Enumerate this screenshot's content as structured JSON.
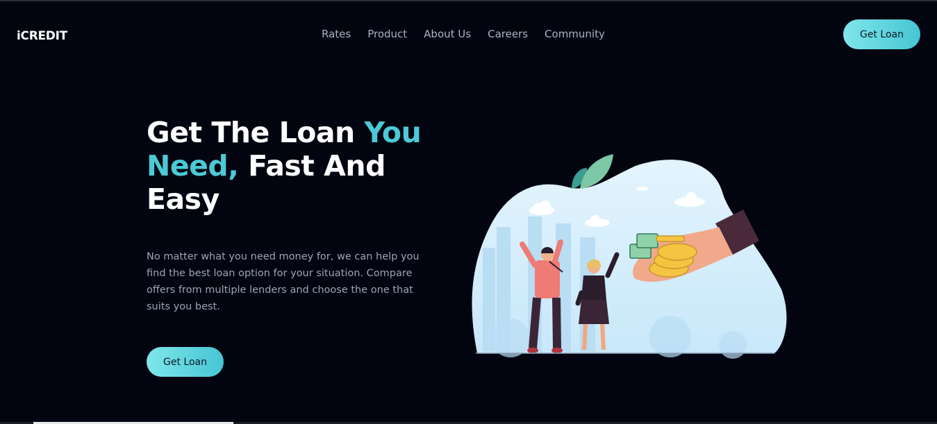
{
  "brand": {
    "logo": "iCREDIT"
  },
  "nav": {
    "items": [
      "Rates",
      "Product",
      "About Us",
      "Careers",
      "Community"
    ]
  },
  "header": {
    "cta_label": "Get Loan"
  },
  "hero": {
    "title_part1": "Get The Loan ",
    "title_accent": "You Need,",
    "title_part2": " Fast And Easy",
    "description": "No matter what you need money for, we can help you find the best loan option for your situation. Compare offers from multiple lenders and choose the one that suits you best.",
    "cta_label": "Get Loan"
  },
  "colors": {
    "background": "#020510",
    "accent": "#4cc9d6",
    "button_gradient_start": "#7fe6ea",
    "button_gradient_end": "#46c5d4"
  },
  "icons": {
    "illustration": "people-celebrating-loan-hand-illustration"
  }
}
